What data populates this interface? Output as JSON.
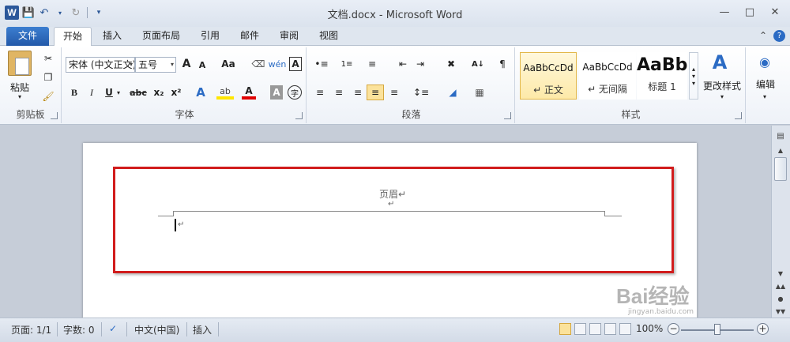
{
  "window": {
    "title": "文档.docx - Microsoft Word",
    "app_icon_letter": "W",
    "qat_icons": [
      "save-icon",
      "undo-icon",
      "redo-icon",
      "customize-icon"
    ]
  },
  "tabs": [
    "文件",
    "开始",
    "插入",
    "页面布局",
    "引用",
    "邮件",
    "审阅",
    "视图"
  ],
  "active_tab": "开始",
  "ribbon": {
    "clipboard": {
      "label": "剪贴板",
      "paste": "粘贴"
    },
    "font": {
      "label": "字体",
      "font_name": "宋体 (中文正文)",
      "font_size": "五号",
      "grow": "A",
      "shrink": "A",
      "change_case": "Aa",
      "bold": "B",
      "italic": "I",
      "underline": "U",
      "strike": "abc",
      "subscript": "x₂",
      "superscript": "x²",
      "color_a": "A"
    },
    "paragraph": {
      "label": "段落"
    },
    "styles": {
      "label": "样式",
      "items": [
        {
          "sample": "AaBbCcDd",
          "name": "↵ 正文",
          "selected": true
        },
        {
          "sample": "AaBbCcDd",
          "name": "↵ 无间隔",
          "selected": false
        },
        {
          "sample": "AaBb",
          "name": "标题 1",
          "selected": false
        }
      ],
      "change_styles": "更改样式"
    },
    "editing": {
      "label": "编辑"
    }
  },
  "document": {
    "header_text": "页眉↵",
    "header_para_mark": "↵",
    "body_para_mark": "↵"
  },
  "status": {
    "page": "页面: 1/1",
    "words": "字数: 0",
    "language": "中文(中国)",
    "mode": "插入",
    "zoom": "100%",
    "zoom_level": 0.5
  },
  "watermark": {
    "text": "Bai经验",
    "url": "jingyan.baidu.com"
  },
  "colors": {
    "highlight_border": "#d11c1c",
    "file_tab": "#2b5797",
    "selected_style": "#fde9a8"
  }
}
